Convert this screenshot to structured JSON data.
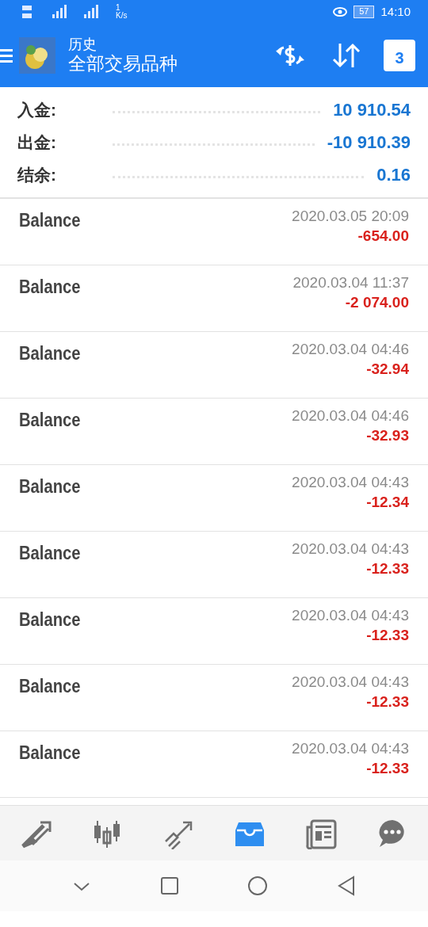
{
  "status_bar": {
    "speed_value": "1",
    "speed_unit": "K/s",
    "battery": "57",
    "time": "14:10"
  },
  "header": {
    "title": "历史",
    "subtitle": "全部交易品种",
    "calendar_day": "3"
  },
  "summary": [
    {
      "label": "入金:",
      "value": "10 910.54"
    },
    {
      "label": "出金:",
      "value": "-10 910.39"
    },
    {
      "label": "结余:",
      "value": "0.16"
    }
  ],
  "deals": [
    {
      "type": "Balance",
      "time": "2020.03.05 20:09",
      "amount": "-654.00"
    },
    {
      "type": "Balance",
      "time": "2020.03.04 11:37",
      "amount": "-2 074.00"
    },
    {
      "type": "Balance",
      "time": "2020.03.04 04:46",
      "amount": "-32.94"
    },
    {
      "type": "Balance",
      "time": "2020.03.04 04:46",
      "amount": "-32.93"
    },
    {
      "type": "Balance",
      "time": "2020.03.04 04:43",
      "amount": "-12.34"
    },
    {
      "type": "Balance",
      "time": "2020.03.04 04:43",
      "amount": "-12.33"
    },
    {
      "type": "Balance",
      "time": "2020.03.04 04:43",
      "amount": "-12.33"
    },
    {
      "type": "Balance",
      "time": "2020.03.04 04:43",
      "amount": "-12.33"
    },
    {
      "type": "Balance",
      "time": "2020.03.04 04:43",
      "amount": "-12.33"
    }
  ],
  "bottom_nav": [
    {
      "kind": "quotes",
      "selected": false
    },
    {
      "kind": "chart",
      "selected": false
    },
    {
      "kind": "trade",
      "selected": false
    },
    {
      "kind": "history",
      "selected": true
    },
    {
      "kind": "news",
      "selected": false
    },
    {
      "kind": "chat",
      "selected": false
    }
  ]
}
